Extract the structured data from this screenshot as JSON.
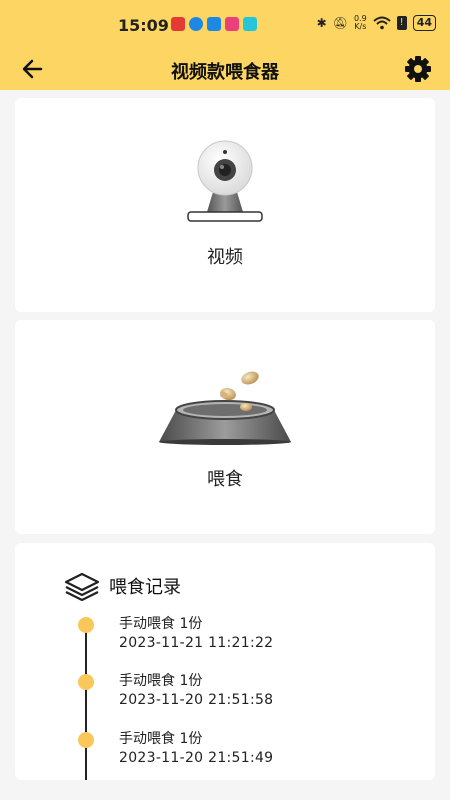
{
  "status_bar": {
    "time": "15:09",
    "speed_top": "0.9",
    "speed_unit": "K/s",
    "battery": "44"
  },
  "header": {
    "title": "视频款喂食器",
    "back_icon": "arrow-left-icon",
    "settings_icon": "gear-icon"
  },
  "video_card": {
    "label": "视频",
    "icon": "camera-icon"
  },
  "feed_card": {
    "label": "喂食",
    "icon": "food-bowl-icon"
  },
  "feeding_log": {
    "title": "喂食记录",
    "icon": "layers-icon",
    "entries": [
      {
        "desc": "手动喂食   1份",
        "date": "2023-11-21 11:21:22"
      },
      {
        "desc": "手动喂食   1份",
        "date": "2023-11-20 21:51:58"
      },
      {
        "desc": "手动喂食   1份",
        "date": "2023-11-20 21:51:49"
      }
    ]
  },
  "colors": {
    "accent": "#fcd562",
    "dot": "#f9c75a",
    "background": "#f5f5f5"
  }
}
